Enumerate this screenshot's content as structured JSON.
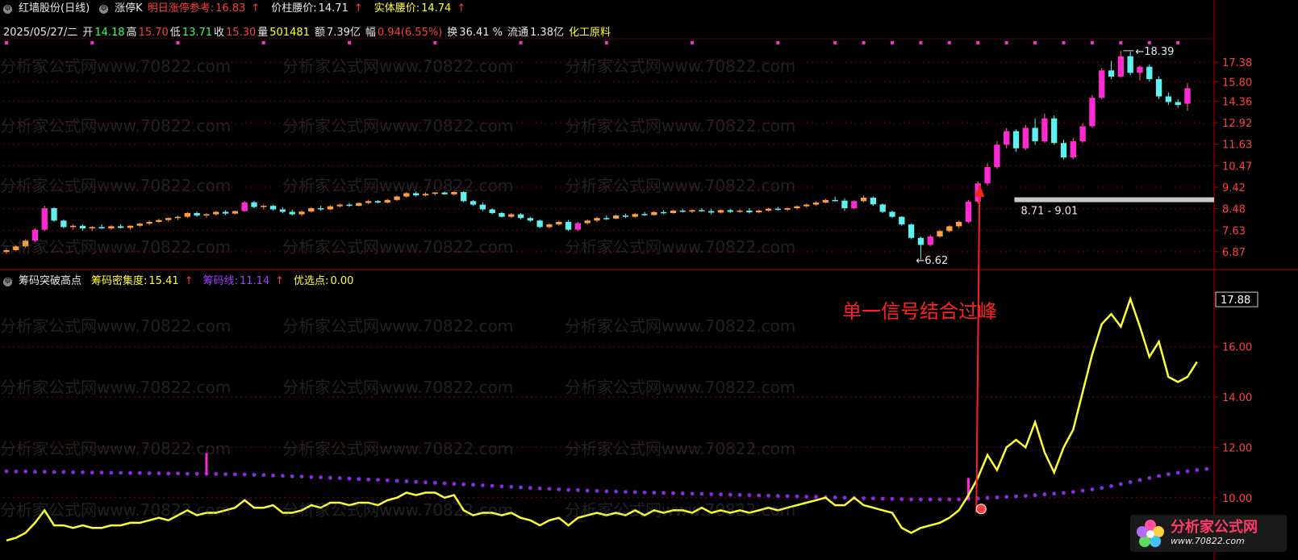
{
  "main_header": {
    "stock": "红墙股份(日线)",
    "indicator_k": "涨停K",
    "tomorrow_label": "明日涨停参考:",
    "tomorrow_value": "16.83",
    "waist_label": "价柱腰价:",
    "waist_value": "14.71",
    "body_label": "实体腰价:",
    "body_value": "14.74"
  },
  "quote_line": {
    "date": "2025/05/27/二",
    "open_label": "开",
    "open": "14.18",
    "high_label": "高",
    "high": "15.70",
    "low_label": "低",
    "low": "13.71",
    "close_label": "收",
    "close": "15.30",
    "vol_label": "量",
    "vol": "501481",
    "amt_label": "额",
    "amt": "7.39亿",
    "chg_label": "幅",
    "chg": "0.94(6.55%)",
    "turn_label": "换",
    "turn": "36.41 %",
    "float_label": "流通",
    "float": "1.38亿",
    "sector": "化工原料"
  },
  "sub_header": {
    "name": "筹码突破高点",
    "density_label": "筹码密集度:",
    "density_value": "15.41",
    "line_label": "筹码线:",
    "line_value": "11.14",
    "pick_label": "优选点:",
    "pick_value": "0.00"
  },
  "price_axis": [
    "17.38",
    "15.80",
    "14.36",
    "12.92",
    "11.63",
    "10.47",
    "9.42",
    "8.48",
    "7.63",
    "6.87"
  ],
  "sub_axis": [
    "17.88",
    "16.00",
    "14.00",
    "12.00",
    "10.00"
  ],
  "annotations": {
    "high_label": "18.39",
    "low_label": "6.62",
    "band_label": "8.71 - 9.01",
    "signal_text": "单一信号结合过峰"
  },
  "watermark": "分析家公式网www.70822.com",
  "logo": {
    "title": "分析家公式网",
    "url": "www.70822.com"
  },
  "colors": {
    "up": "#ff2ad4",
    "down": "#5ff0f0",
    "yellow_line": "#ffff33",
    "purple_dots": "#8a2be2",
    "axis_red": "#b00000",
    "band": "#c8c8c8"
  },
  "chart_data": [
    {
      "type": "candlestick",
      "title": "红墙股份(日线)",
      "y_axis_ticks": [
        17.38,
        15.8,
        14.36,
        12.92,
        11.63,
        10.47,
        9.42,
        8.48,
        7.63,
        6.87
      ],
      "ohlc": [
        [
          6.86,
          6.96,
          6.8,
          6.92
        ],
        [
          6.92,
          7.1,
          6.88,
          7.05
        ],
        [
          7.05,
          7.3,
          7.0,
          7.25
        ],
        [
          7.25,
          7.7,
          7.2,
          7.65
        ],
        [
          7.65,
          8.6,
          7.6,
          8.5
        ],
        [
          8.5,
          8.55,
          7.95,
          8.0
        ],
        [
          8.0,
          8.05,
          7.7,
          7.75
        ],
        [
          7.75,
          7.85,
          7.65,
          7.8
        ],
        [
          7.8,
          7.85,
          7.62,
          7.7
        ],
        [
          7.7,
          7.8,
          7.6,
          7.75
        ],
        [
          7.75,
          7.85,
          7.68,
          7.7
        ],
        [
          7.7,
          7.82,
          7.65,
          7.78
        ],
        [
          7.78,
          7.86,
          7.7,
          7.72
        ],
        [
          7.72,
          7.82,
          7.66,
          7.8
        ],
        [
          7.8,
          7.92,
          7.75,
          7.88
        ],
        [
          7.88,
          8.0,
          7.82,
          7.95
        ],
        [
          7.95,
          8.08,
          7.9,
          8.02
        ],
        [
          8.02,
          8.12,
          7.95,
          8.1
        ],
        [
          8.1,
          8.2,
          8.02,
          8.15
        ],
        [
          8.15,
          8.35,
          8.1,
          8.3
        ],
        [
          8.3,
          8.36,
          8.15,
          8.2
        ],
        [
          8.2,
          8.3,
          8.12,
          8.25
        ],
        [
          8.25,
          8.38,
          8.2,
          8.35
        ],
        [
          8.35,
          8.42,
          8.22,
          8.28
        ],
        [
          8.28,
          8.4,
          8.24,
          8.38
        ],
        [
          8.38,
          8.8,
          8.35,
          8.75
        ],
        [
          8.75,
          8.82,
          8.5,
          8.55
        ],
        [
          8.55,
          8.65,
          8.45,
          8.6
        ],
        [
          8.6,
          8.65,
          8.4,
          8.45
        ],
        [
          8.45,
          8.55,
          8.3,
          8.35
        ],
        [
          8.35,
          8.45,
          8.2,
          8.25
        ],
        [
          8.25,
          8.4,
          8.18,
          8.36
        ],
        [
          8.36,
          8.55,
          8.32,
          8.5
        ],
        [
          8.5,
          8.6,
          8.4,
          8.45
        ],
        [
          8.45,
          8.62,
          8.42,
          8.58
        ],
        [
          8.58,
          8.7,
          8.52,
          8.65
        ],
        [
          8.65,
          8.72,
          8.55,
          8.6
        ],
        [
          8.6,
          8.75,
          8.58,
          8.72
        ],
        [
          8.72,
          8.86,
          8.66,
          8.8
        ],
        [
          8.8,
          8.84,
          8.7,
          8.74
        ],
        [
          8.74,
          8.9,
          8.7,
          8.85
        ],
        [
          8.85,
          9.05,
          8.8,
          9.0
        ],
        [
          9.0,
          9.2,
          8.95,
          9.15
        ],
        [
          9.15,
          9.22,
          9.0,
          9.05
        ],
        [
          9.05,
          9.2,
          9.0,
          9.12
        ],
        [
          9.12,
          9.2,
          9.05,
          9.18
        ],
        [
          9.18,
          9.22,
          9.08,
          9.1
        ],
        [
          9.1,
          9.25,
          9.05,
          9.2
        ],
        [
          9.2,
          9.24,
          8.75,
          8.8
        ],
        [
          8.8,
          8.85,
          8.6,
          8.65
        ],
        [
          8.65,
          8.75,
          8.38,
          8.45
        ],
        [
          8.45,
          8.5,
          8.25,
          8.3
        ],
        [
          8.3,
          8.35,
          8.12,
          8.15
        ],
        [
          8.15,
          8.3,
          8.1,
          8.25
        ],
        [
          8.25,
          8.3,
          8.05,
          8.1
        ],
        [
          8.1,
          8.15,
          7.95,
          8.0
        ],
        [
          8.0,
          8.05,
          7.7,
          7.75
        ],
        [
          7.75,
          7.9,
          7.7,
          7.85
        ],
        [
          7.85,
          8.0,
          7.8,
          7.95
        ],
        [
          7.95,
          8.02,
          7.6,
          7.65
        ],
        [
          7.65,
          7.95,
          7.6,
          7.9
        ],
        [
          7.9,
          8.05,
          7.85,
          8.0
        ],
        [
          8.0,
          8.15,
          7.95,
          8.1
        ],
        [
          8.1,
          8.2,
          8.02,
          8.08
        ],
        [
          8.08,
          8.25,
          8.05,
          8.2
        ],
        [
          8.2,
          8.28,
          8.1,
          8.15
        ],
        [
          8.15,
          8.3,
          8.1,
          8.26
        ],
        [
          8.26,
          8.35,
          8.18,
          8.22
        ],
        [
          8.22,
          8.38,
          8.2,
          8.34
        ],
        [
          8.34,
          8.42,
          8.26,
          8.3
        ],
        [
          8.3,
          8.44,
          8.28,
          8.4
        ],
        [
          8.4,
          8.48,
          8.32,
          8.36
        ],
        [
          8.36,
          8.46,
          8.3,
          8.42
        ],
        [
          8.42,
          8.5,
          8.35,
          8.38
        ],
        [
          8.38,
          8.48,
          8.25,
          8.32
        ],
        [
          8.32,
          8.45,
          8.28,
          8.42
        ],
        [
          8.42,
          8.48,
          8.3,
          8.35
        ],
        [
          8.35,
          8.46,
          8.3,
          8.4
        ],
        [
          8.4,
          8.5,
          8.28,
          8.33
        ],
        [
          8.33,
          8.44,
          8.28,
          8.4
        ],
        [
          8.4,
          8.52,
          8.36,
          8.48
        ],
        [
          8.48,
          8.56,
          8.4,
          8.44
        ],
        [
          8.44,
          8.55,
          8.38,
          8.5
        ],
        [
          8.5,
          8.62,
          8.45,
          8.58
        ],
        [
          8.58,
          8.7,
          8.52,
          8.65
        ],
        [
          8.65,
          8.8,
          8.6,
          8.74
        ],
        [
          8.74,
          8.9,
          8.7,
          8.85
        ],
        [
          8.85,
          9.0,
          8.78,
          8.82
        ],
        [
          8.82,
          8.92,
          8.4,
          8.5
        ],
        [
          8.5,
          8.85,
          8.45,
          8.8
        ],
        [
          8.8,
          9.05,
          8.75,
          8.95
        ],
        [
          8.95,
          9.0,
          8.6,
          8.66
        ],
        [
          8.66,
          8.7,
          8.3,
          8.35
        ],
        [
          8.35,
          8.4,
          8.1,
          8.15
        ],
        [
          8.15,
          8.18,
          7.8,
          7.85
        ],
        [
          7.85,
          7.88,
          7.3,
          7.35
        ],
        [
          7.35,
          7.4,
          6.62,
          7.1
        ],
        [
          7.1,
          7.45,
          7.05,
          7.4
        ],
        [
          7.4,
          7.65,
          7.35,
          7.6
        ],
        [
          7.6,
          7.82,
          7.55,
          7.78
        ],
        [
          7.78,
          8.0,
          7.7,
          7.95
        ],
        [
          7.95,
          8.85,
          7.9,
          8.78
        ],
        [
          8.78,
          9.7,
          8.7,
          9.6
        ],
        [
          9.6,
          10.6,
          9.5,
          10.4
        ],
        [
          10.4,
          11.8,
          10.3,
          11.6
        ],
        [
          11.6,
          12.6,
          11.4,
          12.4
        ],
        [
          12.4,
          12.5,
          11.2,
          11.4
        ],
        [
          11.4,
          12.8,
          11.3,
          12.6
        ],
        [
          12.6,
          13.2,
          11.6,
          11.8
        ],
        [
          11.8,
          13.5,
          11.7,
          13.2
        ],
        [
          13.2,
          13.4,
          11.6,
          11.7
        ],
        [
          11.7,
          11.9,
          10.8,
          10.9
        ],
        [
          10.9,
          12.0,
          10.8,
          11.8
        ],
        [
          11.8,
          12.9,
          11.7,
          12.7
        ],
        [
          12.7,
          14.8,
          12.6,
          14.6
        ],
        [
          14.6,
          16.9,
          14.5,
          16.7
        ],
        [
          16.7,
          17.5,
          16.0,
          16.2
        ],
        [
          16.2,
          18.39,
          16.1,
          17.9
        ],
        [
          17.9,
          18.3,
          16.3,
          16.5
        ],
        [
          16.5,
          17.1,
          15.9,
          17.0
        ],
        [
          17.0,
          17.2,
          15.8,
          16.0
        ],
        [
          16.0,
          16.2,
          14.5,
          14.7
        ],
        [
          14.7,
          15.0,
          14.1,
          14.3
        ],
        [
          14.3,
          14.5,
          13.9,
          14.1
        ],
        [
          14.18,
          15.7,
          13.71,
          15.3
        ]
      ]
    },
    {
      "type": "line",
      "title": "筹码突破高点",
      "y_axis_ticks": [
        17.88,
        16.0,
        14.0,
        12.0,
        10.0
      ],
      "series": [
        {
          "name": "筹码密集度",
          "values": [
            8.3,
            8.4,
            8.6,
            9.0,
            9.5,
            8.9,
            8.9,
            8.8,
            8.9,
            8.8,
            8.8,
            8.9,
            8.9,
            9.0,
            9.0,
            9.1,
            9.2,
            9.1,
            9.3,
            9.5,
            9.3,
            9.4,
            9.4,
            9.5,
            9.6,
            9.9,
            9.6,
            9.6,
            9.7,
            9.4,
            9.4,
            9.5,
            9.7,
            9.6,
            9.8,
            9.8,
            9.7,
            9.8,
            9.8,
            9.7,
            9.9,
            10.0,
            10.2,
            10.1,
            10.2,
            10.2,
            10.0,
            10.1,
            9.5,
            9.3,
            9.4,
            9.4,
            9.3,
            9.4,
            9.2,
            9.1,
            8.9,
            9.1,
            9.2,
            8.9,
            9.2,
            9.3,
            9.4,
            9.3,
            9.4,
            9.3,
            9.5,
            9.3,
            9.5,
            9.4,
            9.5,
            9.5,
            9.4,
            9.6,
            9.4,
            9.5,
            9.4,
            9.5,
            9.4,
            9.5,
            9.6,
            9.5,
            9.6,
            9.7,
            9.8,
            9.9,
            10.0,
            9.7,
            9.7,
            10.0,
            9.7,
            9.6,
            9.5,
            9.4,
            8.8,
            8.6,
            8.8,
            8.9,
            9.0,
            9.2,
            9.5,
            10.1,
            10.8,
            11.7,
            11.1,
            12.0,
            12.3,
            12.0,
            13.0,
            11.8,
            11.0,
            12.0,
            12.7,
            14.2,
            15.7,
            16.9,
            17.3,
            16.8,
            17.9,
            16.8,
            15.6,
            16.2,
            14.8,
            14.6,
            14.8,
            15.4
          ]
        },
        {
          "name": "筹码线",
          "values": [
            11.05,
            11.04,
            11.04,
            11.03,
            11.03,
            11.02,
            11.02,
            11.01,
            11.01,
            11.0,
            11.0,
            10.99,
            10.99,
            10.98,
            10.98,
            10.97,
            10.97,
            10.96,
            10.96,
            10.95,
            10.95,
            10.94,
            10.94,
            10.93,
            10.93,
            10.92,
            10.91,
            10.9,
            10.88,
            10.87,
            10.85,
            10.84,
            10.82,
            10.81,
            10.79,
            10.78,
            10.76,
            10.74,
            10.72,
            10.71,
            10.69,
            10.67,
            10.65,
            10.63,
            10.61,
            10.59,
            10.57,
            10.55,
            10.53,
            10.51,
            10.49,
            10.47,
            10.45,
            10.43,
            10.41,
            10.39,
            10.37,
            10.35,
            10.33,
            10.31,
            10.3,
            10.28,
            10.27,
            10.25,
            10.24,
            10.23,
            10.22,
            10.21,
            10.2,
            10.19,
            10.18,
            10.17,
            10.16,
            10.15,
            10.14,
            10.13,
            10.12,
            10.11,
            10.1,
            10.09,
            10.08,
            10.07,
            10.06,
            10.05,
            10.04,
            10.03,
            10.02,
            10.01,
            10.0,
            9.99,
            9.98,
            9.97,
            9.96,
            9.95,
            9.94,
            9.93,
            9.93,
            9.93,
            9.93,
            9.93,
            9.93,
            9.95,
            9.97,
            9.99,
            10.01,
            10.03,
            10.05,
            10.07,
            10.1,
            10.13,
            10.16,
            10.19,
            10.23,
            10.28,
            10.33,
            10.39,
            10.46,
            10.54,
            10.62,
            10.7,
            10.78,
            10.86,
            10.93,
            10.99,
            11.05,
            11.1,
            11.14
          ]
        }
      ]
    }
  ]
}
